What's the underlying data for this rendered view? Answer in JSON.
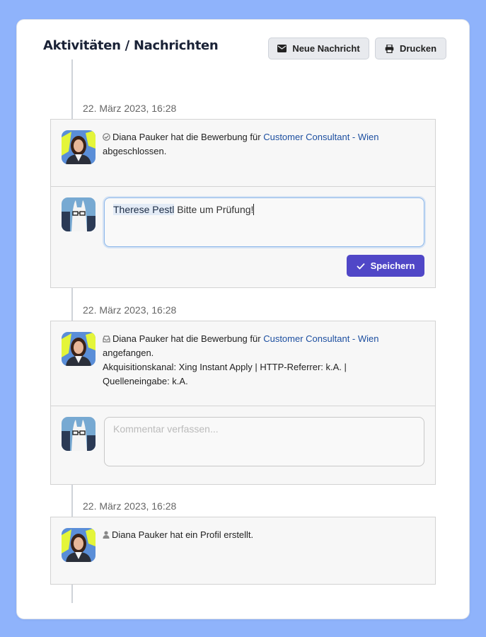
{
  "header": {
    "title": "Aktivitäten / Nachrichten",
    "new_message_label": "Neue Nachricht",
    "print_label": "Drucken"
  },
  "entries": [
    {
      "date": "22. März 2023, 16:28",
      "icon": "check-circle-icon",
      "text_before": "Diana Pauker hat die Bewerbung für",
      "link": "Customer Consultant - Wien",
      "text_after": "abgeschlossen.",
      "comment": {
        "mention": "Therese Pestl",
        "text": " Bitte um Prüfung!",
        "save_label": "Speichern"
      }
    },
    {
      "date": "22. März 2023, 16:28",
      "icon": "inbox-icon",
      "text_before": "Diana Pauker hat die Bewerbung für",
      "link": "Customer Consultant - Wien",
      "text_after": "angefangen.",
      "details_1": "Akquisitionskanal: Xing Instant Apply | HTTP-Referrer: k.A. |",
      "details_2": "Quelleneingabe: k.A.",
      "comment": {
        "placeholder": "Kommentar verfassen..."
      }
    },
    {
      "date": "22. März 2023, 16:28",
      "icon": "user-icon",
      "text": "Diana Pauker hat ein Profil erstellt."
    }
  ],
  "colors": {
    "background": "#8fb3fb",
    "primary_button": "#5047c7",
    "link": "#1d4fa0"
  }
}
